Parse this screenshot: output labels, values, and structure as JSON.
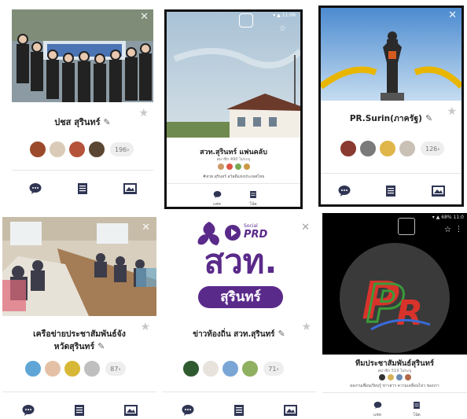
{
  "cards": [
    {
      "title": "ปชส สุรินทร์",
      "member_count": "196"
    },
    {
      "status_time": "11:09",
      "title": "สวท.สุรินทร์ แฟนคลับ",
      "meta": "สมาชิก 490 ไม่ระบุ",
      "tagline": "#สวท.สุรินทร์ สวัสดีแห่งประเทศไทย",
      "action_labels": [
        "แชท",
        "โน้ต"
      ]
    },
    {
      "title": "PR.Surin(ภาครัฐ)",
      "member_count": "126"
    },
    {
      "title_line1": "เครือข่ายประชาสัมพันธ์จัง",
      "title_line2": "หวัดสุรินทร์",
      "member_count": "87"
    },
    {
      "logo": {
        "badge": "Social",
        "brand": "PRD",
        "main": "สวท.",
        "sub": "สุรินทร์"
      },
      "title": "ข่าวท้องถิ่น สวท.สุรินทร์",
      "member_count": "71"
    },
    {
      "status_time": "11:0",
      "status_battery": "68%",
      "title": "ทีมประชาสัมพันธ์สุรินทร์",
      "meta": "สมาชิก 519 ไม่ระบุ",
      "tagline": "ผลงานเพื่อนเรียนรู้ ข่าวสาร ความเคลื่อนไหว ของเรา",
      "action_labels": [
        "แชท",
        "โน้ต"
      ]
    }
  ],
  "colors": {
    "accent": "#2f3553",
    "badge_bg": "#eeeeee",
    "prd_purple": "#5a2a8a",
    "prd_logo_red": "#d8332b",
    "prd_logo_green": "#3a9a3a"
  },
  "icons": [
    "chat-icon",
    "note-icon",
    "album-icon",
    "star-icon",
    "edit-pencil-icon",
    "close-icon",
    "qr-icon"
  ]
}
